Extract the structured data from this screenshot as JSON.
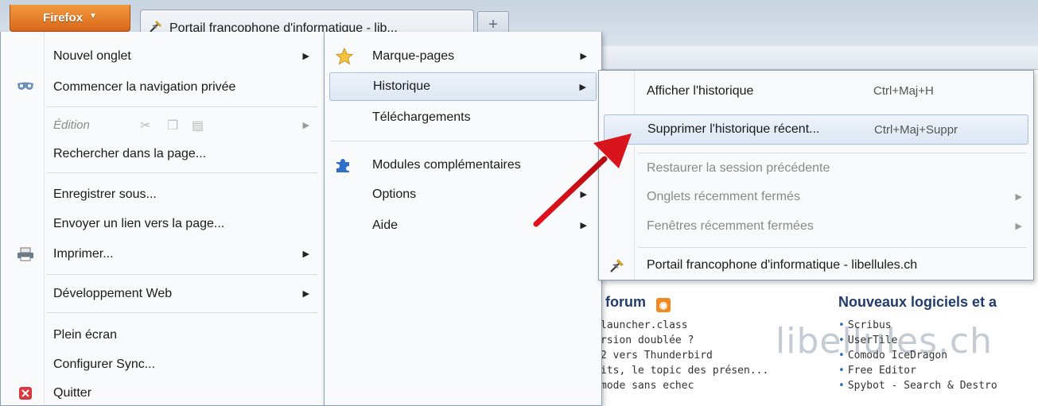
{
  "titlebar": {
    "firefox_button": "Firefox",
    "tab_title": "Portail francophone d'informatique - lib...",
    "new_tab_symbol": "+"
  },
  "main_menu": {
    "items": [
      {
        "label": "Nouvel onglet",
        "has_submenu": true
      },
      {
        "label": "Commencer la navigation privée",
        "icon": "private-mask-icon"
      },
      {
        "label": "Édition",
        "has_submenu": true,
        "disabled": true,
        "icons": [
          "cut-icon",
          "copy-icon",
          "paste-icon"
        ]
      },
      {
        "label": "Rechercher dans la page..."
      },
      {
        "label": "Enregistrer sous..."
      },
      {
        "label": "Envoyer un lien vers la page..."
      },
      {
        "label": "Imprimer...",
        "has_submenu": true,
        "icon": "printer-icon"
      },
      {
        "label": "Développement Web",
        "has_submenu": true
      },
      {
        "label": "Plein écran"
      },
      {
        "label": "Configurer Sync..."
      },
      {
        "label": "Quitter",
        "icon": "quit-icon"
      }
    ]
  },
  "sub_menu": {
    "items": [
      {
        "label": "Marque-pages",
        "has_submenu": true,
        "icon": "star-icon"
      },
      {
        "label": "Historique",
        "has_submenu": true,
        "highlighted": true
      },
      {
        "label": "Téléchargements"
      },
      {
        "label": "Modules complémentaires",
        "icon": "puzzle-icon"
      },
      {
        "label": "Options",
        "has_submenu": true
      },
      {
        "label": "Aide",
        "has_submenu": true
      }
    ]
  },
  "history_menu": {
    "items": [
      {
        "label": "Afficher l'historique",
        "shortcut": "Ctrl+Maj+H"
      },
      {
        "label": "Supprimer l'historique récent...",
        "shortcut": "Ctrl+Maj+Suppr",
        "highlighted": true
      },
      {
        "label": "Restaurer la session précédente",
        "disabled": true
      },
      {
        "label": "Onglets récemment fermés",
        "disabled": true,
        "has_submenu": true
      },
      {
        "label": "Fenêtres récemment fermées",
        "disabled": true,
        "has_submenu": true
      },
      {
        "label": "Portail francophone d'informatique - libellules.ch",
        "icon": "dragonfly-icon"
      }
    ]
  },
  "page": {
    "forum_title": "u forum",
    "forum_items": [
      "launcher.class",
      "rsion doublée ?",
      "2 vers Thunderbird",
      "its, le topic des présen...",
      "mode sans echec"
    ],
    "software_title": "Nouveaux logiciels et a",
    "software_items": [
      "Scribus",
      "UserTile",
      "Comodo IceDragon",
      "Free Editor",
      "Spybot - Search & Destro"
    ],
    "watermark": "libellules.ch"
  },
  "colors": {
    "firefox_orange": "#e07a25",
    "highlight_border": "#a8bfdc",
    "arrow_red": "#d8141c",
    "link_blue": "#1f3c6b"
  }
}
